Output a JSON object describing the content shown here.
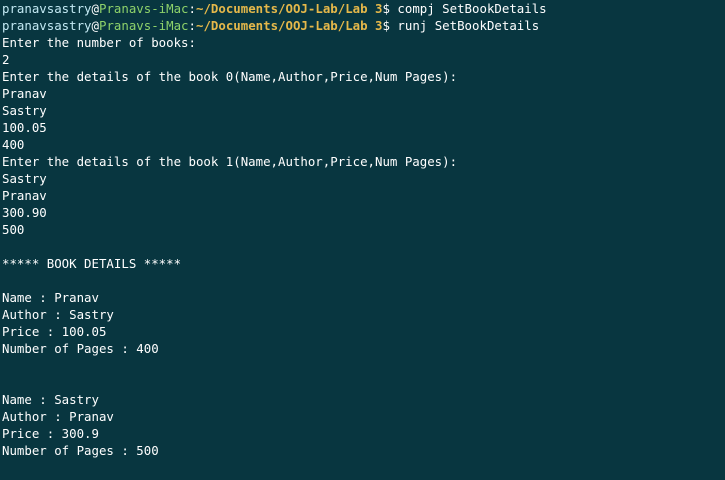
{
  "colors": {
    "background": "#083640",
    "text": "#ffffff",
    "user": "#c3e9f3",
    "host": "#8ed26a",
    "path": "#e5b84a"
  },
  "prompts": [
    {
      "user": "pranavsastry",
      "at": "@",
      "host": "Pranavs-iMac",
      "colon": ":",
      "path": "~/Documents/OOJ-Lab/Lab 3",
      "symbol": "$ ",
      "command": "compj SetBookDetails"
    },
    {
      "user": "pranavsastry",
      "at": "@",
      "host": "Pranavs-iMac",
      "colon": ":",
      "path": "~/Documents/OOJ-Lab/Lab 3",
      "symbol": "$ ",
      "command": "runj SetBookDetails"
    }
  ],
  "output": [
    "Enter the number of books:",
    "2",
    "Enter the details of the book 0(Name,Author,Price,Num Pages):",
    "Pranav",
    "Sastry",
    "100.05",
    "400",
    "Enter the details of the book 1(Name,Author,Price,Num Pages):",
    "Sastry",
    "Pranav",
    "300.90",
    "500",
    "",
    "***** BOOK DETAILS *****",
    "",
    "Name : Pranav",
    "Author : Sastry",
    "Price : 100.05",
    "Number of Pages : 400",
    "",
    "",
    "Name : Sastry",
    "Author : Pranav",
    "Price : 300.9",
    "Number of Pages : 500"
  ]
}
